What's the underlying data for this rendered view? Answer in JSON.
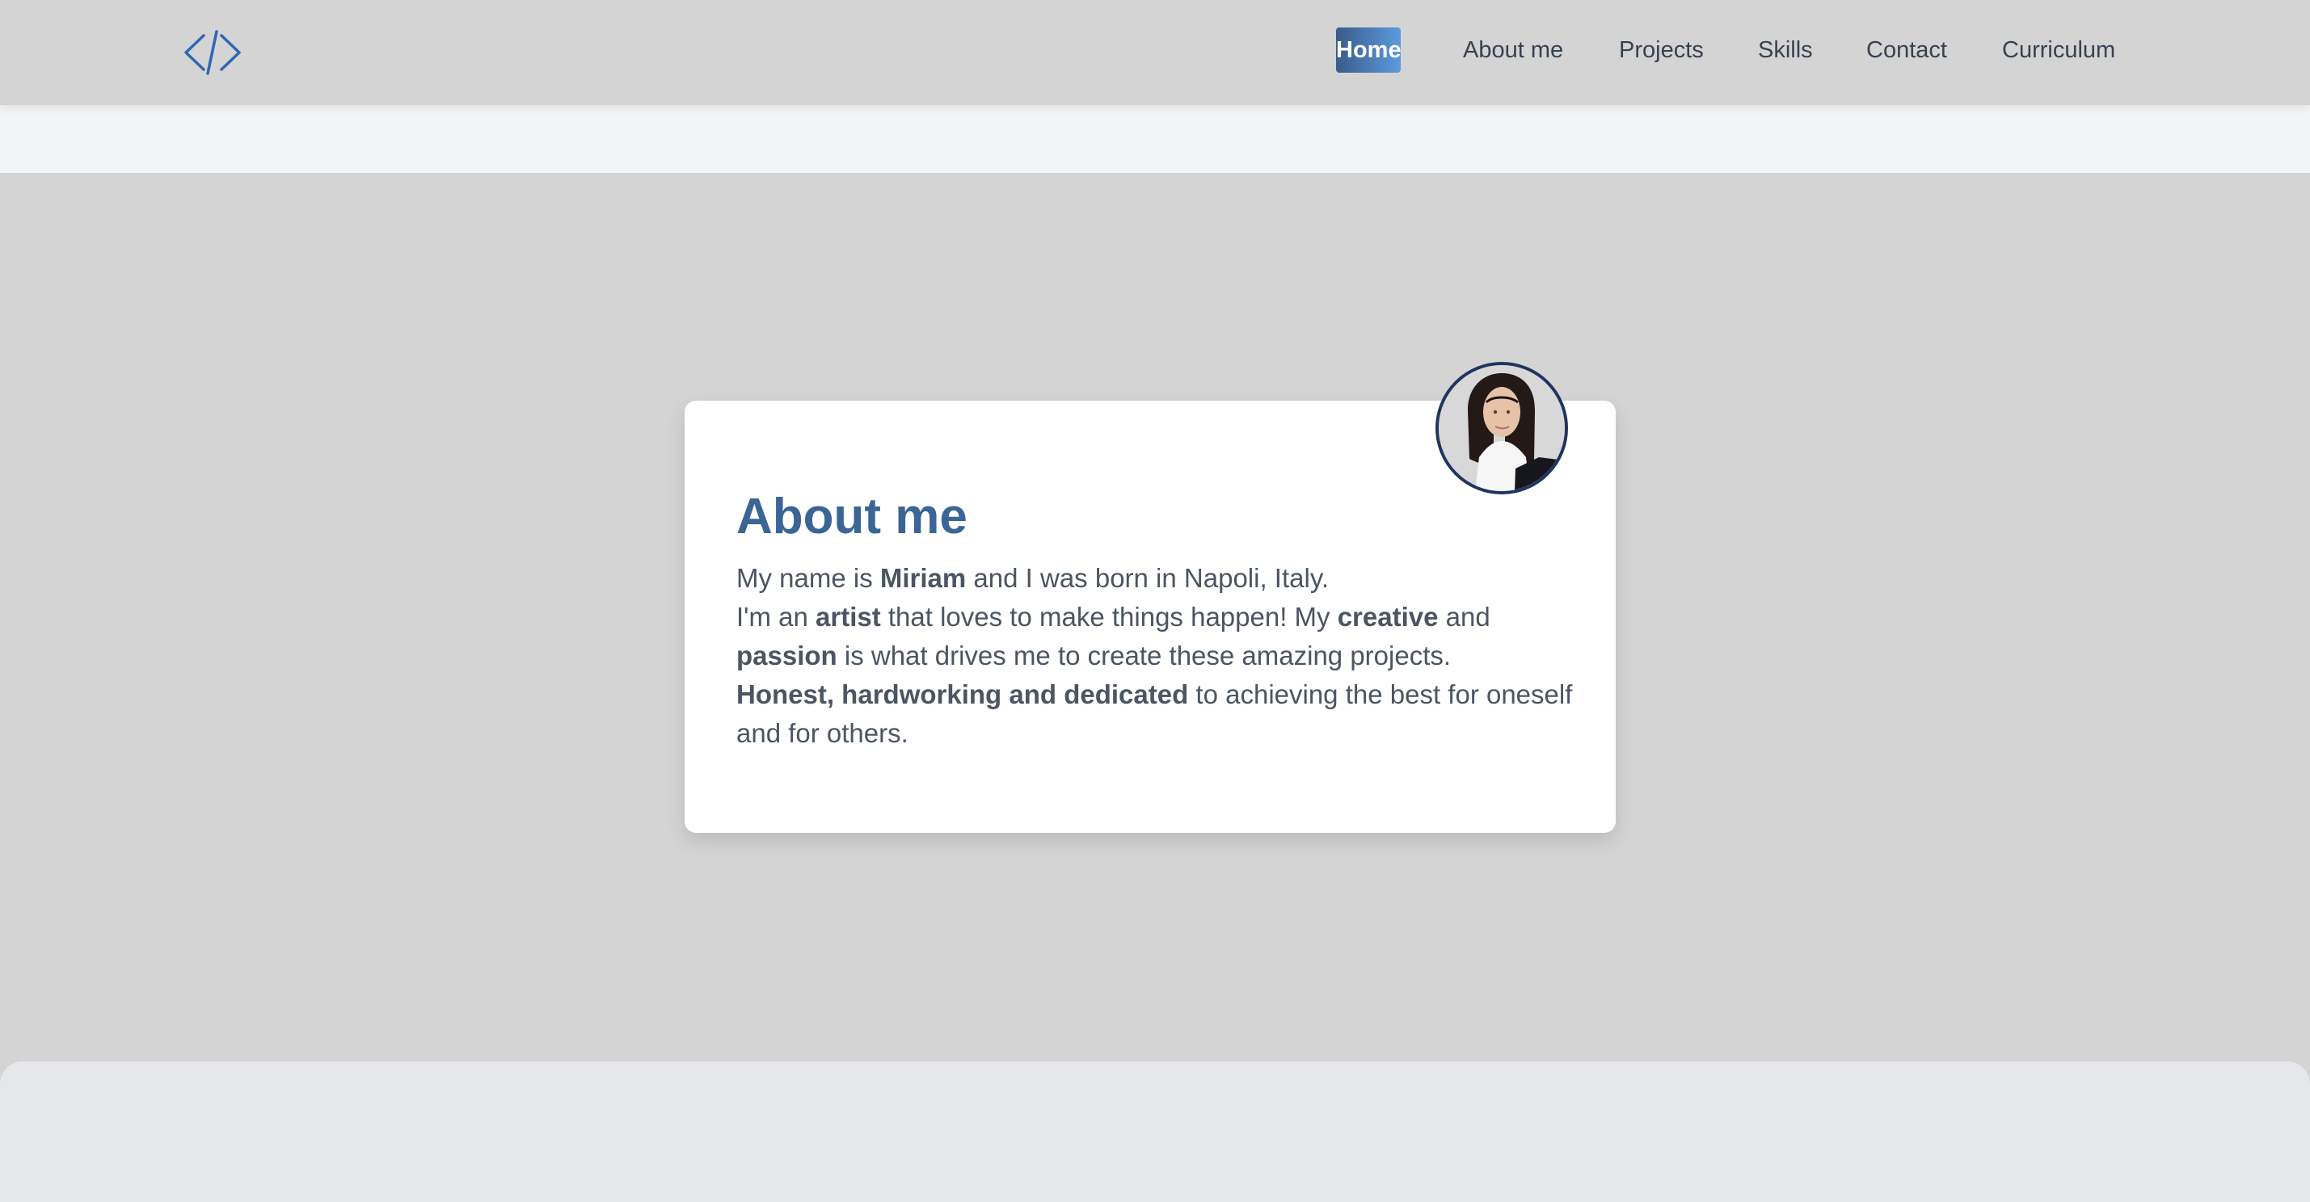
{
  "nav": {
    "items": [
      {
        "label": "Home",
        "active": true
      },
      {
        "label": "About me"
      },
      {
        "label": "Projects"
      },
      {
        "label": "Skills"
      },
      {
        "label": "Contact"
      },
      {
        "label": "Curriculum"
      }
    ]
  },
  "about": {
    "title": "About me",
    "lines": [
      {
        "parts": [
          {
            "text": "My name is "
          },
          {
            "text": "Miriam",
            "bold": true
          },
          {
            "text": " and I was born in Napoli, Italy."
          }
        ]
      },
      {
        "parts": [
          {
            "text": "I'm an "
          },
          {
            "text": "artist",
            "bold": true
          },
          {
            "text": " that loves to make things happen! My "
          },
          {
            "text": "creative",
            "bold": true
          },
          {
            "text": " and "
          },
          {
            "text": "passion",
            "bold": true
          },
          {
            "text": " is what drives me to create these amazing projects."
          }
        ]
      },
      {
        "parts": [
          {
            "text": "Honest, hardworking and dedicated",
            "bold": true
          },
          {
            "text": " to achieving the best for oneself and for others."
          }
        ]
      }
    ]
  },
  "colors": {
    "background": "#d4d4d4",
    "accent": "#3a6595",
    "nav_active_start": "#3a5a8c",
    "nav_active_end": "#5b9bdc",
    "card": "#ffffff",
    "footer": "#e5e7eb"
  },
  "icons": {
    "logo": "code-brackets-icon",
    "avatar": "profile-photo"
  }
}
